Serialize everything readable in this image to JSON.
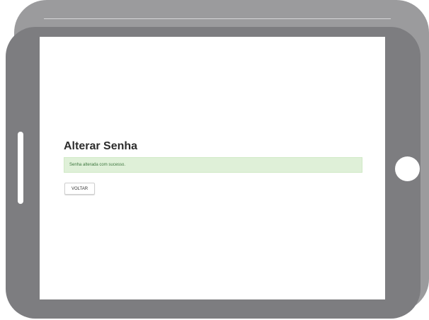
{
  "device": {
    "frame_color": "#7d7d80",
    "back_color": "#9b9b9d",
    "screen_color": "#ffffff",
    "home_button_icon": "home-button",
    "side_button_icon": "side-button"
  },
  "page": {
    "title": "Alterar Senha",
    "alert": {
      "type": "success",
      "message": "Senha alterada com sucesso.",
      "background": "#dff0d8",
      "text_color": "#3c763d"
    },
    "back_button_label": "VOLTAR"
  }
}
